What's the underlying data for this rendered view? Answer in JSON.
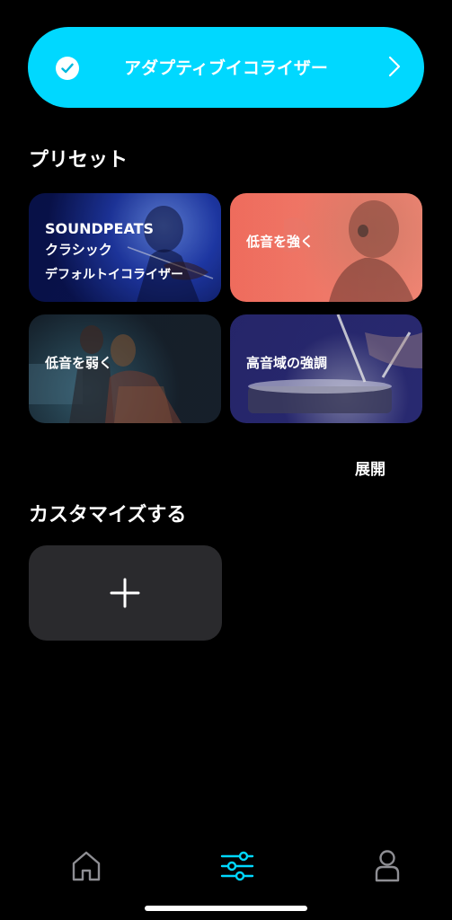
{
  "adaptive_eq": {
    "label": "アダプティブイコライザー",
    "enabled": true
  },
  "presets": {
    "title": "プリセット",
    "cards": [
      {
        "lines": [
          "SOUNDPEATS",
          "クラシック",
          "デフォルトイコライザー"
        ]
      },
      {
        "lines": [
          "低音を強く"
        ]
      },
      {
        "lines": [
          "低音を弱く"
        ]
      },
      {
        "lines": [
          "高音域の強調"
        ]
      }
    ],
    "expand_label": "展開"
  },
  "custom": {
    "title": "カスタマイズする"
  },
  "tabs": [
    {
      "icon": "home-icon",
      "active": false
    },
    {
      "icon": "equalizer-icon",
      "active": true
    },
    {
      "icon": "profile-icon",
      "active": false
    }
  ],
  "colors": {
    "accent": "#00d8ff",
    "card_bg": "#2a2a2d",
    "inactive_icon": "#8e8e93"
  }
}
